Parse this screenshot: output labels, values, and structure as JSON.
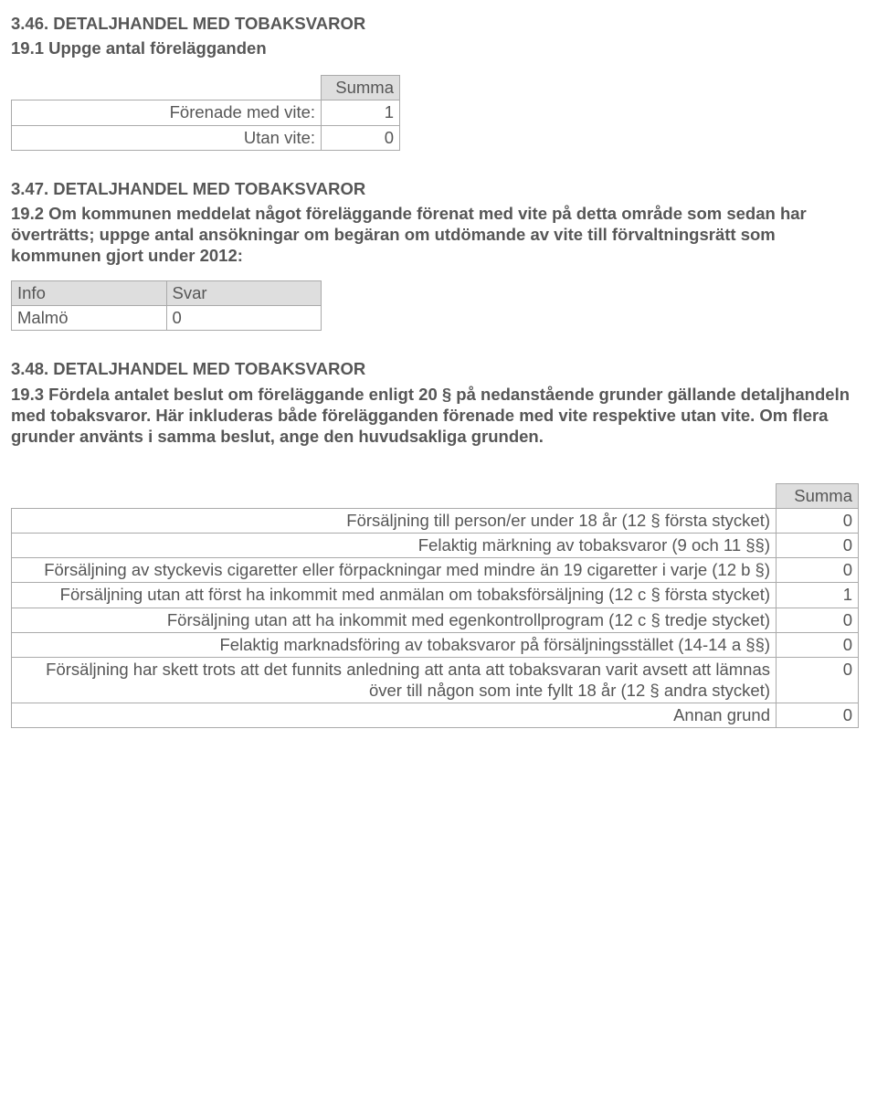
{
  "sec346": {
    "title": "3.46. DETALJHANDEL MED TOBAKSVAROR",
    "subtitle": "19.1 Uppge antal förelägganden",
    "col_header": "Summa",
    "rows": [
      {
        "label": "Förenade med vite:",
        "value": "1"
      },
      {
        "label": "Utan vite:",
        "value": "0"
      }
    ]
  },
  "sec347": {
    "title": "3.47. DETALJHANDEL MED TOBAKSVAROR",
    "para": "19.2 Om kommunen meddelat något föreläggande förenat med vite på detta område som sedan har överträtts; uppge antal ansökningar om begäran om utdömande av vite till förvaltningsrätt som kommunen gjort under 2012:",
    "col1": "Info",
    "col2": "Svar",
    "row_label": "Malmö",
    "row_value": "0"
  },
  "sec348": {
    "title": "3.48. DETALJHANDEL MED TOBAKSVAROR",
    "para": "19.3 Fördela antalet beslut om föreläggande enligt 20 § på nedanstående grunder gällande detaljhandeln med tobaksvaror. Här inkluderas både förelägganden förenade med vite respektive utan vite. Om flera grunder använts i samma beslut, ange den huvudsakliga grunden.",
    "col_header": "Summa",
    "rows": [
      {
        "label": "Försäljning till person/er under 18 år (12 § första stycket)",
        "value": "0"
      },
      {
        "label": "Felaktig märkning av tobaksvaror (9 och 11 §§)",
        "value": "0"
      },
      {
        "label": "Försäljning av styckevis cigaretter eller förpackningar med mindre än 19 cigaretter i varje (12 b §)",
        "value": "0"
      },
      {
        "label": "Försäljning utan att först ha inkommit med anmälan om tobaksförsäljning (12 c § första stycket)",
        "value": "1"
      },
      {
        "label": "Försäljning utan att ha inkommit med egenkontrollprogram (12 c § tredje stycket)",
        "value": "0"
      },
      {
        "label": "Felaktig marknadsföring av tobaksvaror på försäljningsstället (14-14 a §§)",
        "value": "0"
      },
      {
        "label": "Försäljning har skett trots att det funnits anledning att anta att tobaksvaran varit avsett att lämnas över till någon som inte fyllt 18 år (12 § andra stycket)",
        "value": "0"
      },
      {
        "label": "Annan grund",
        "value": "0"
      }
    ]
  }
}
